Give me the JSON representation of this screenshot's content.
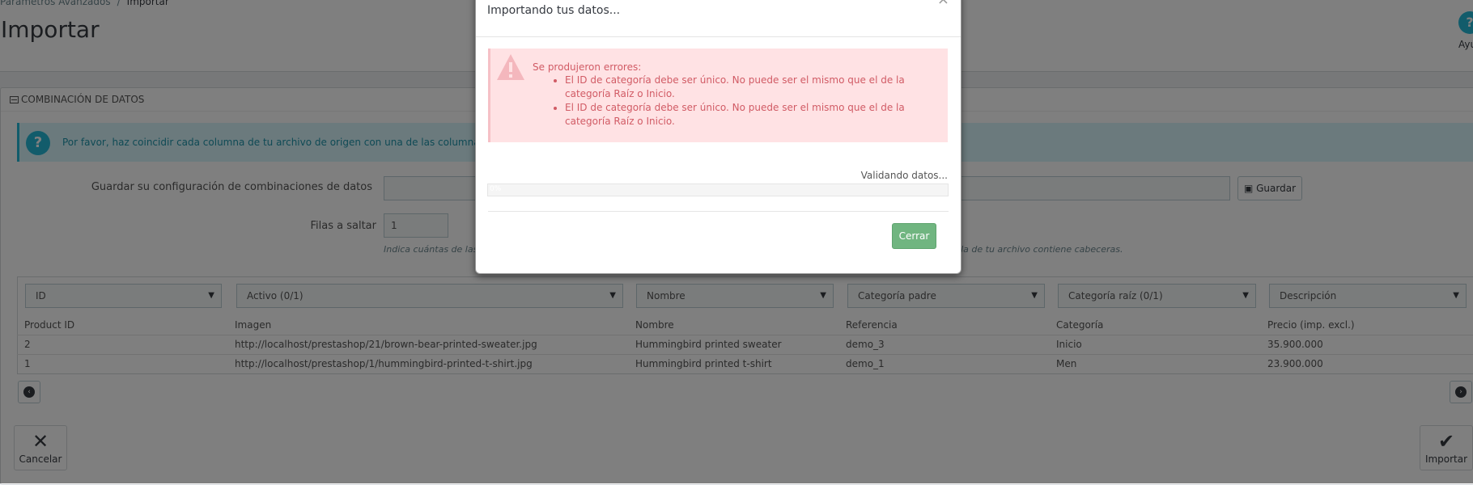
{
  "header": {
    "breadcrumb": [
      "Parámetros Avanzados",
      "Importar"
    ],
    "title": "Importar",
    "help_label": "Ayuda"
  },
  "panel": {
    "heading": "COMBINACIÓN DE DATOS",
    "info_text": "Por favor, haz coincidir cada columna de tu archivo de origen con una de las columnas de d",
    "save_config_label": "Guardar su configuración de combinaciones de datos",
    "save_config_value": "",
    "save_button": "Guardar",
    "skip_rows_label": "Filas a saltar",
    "skip_rows_value": "1",
    "help_left": "Indica cuántas de las",
    "help_right": "fila de tu archivo contiene cabeceras.",
    "selects": [
      "ID",
      "Activo (0/1)",
      "Nombre",
      "Categoría padre",
      "Categoría raíz (0/1)",
      "Descripción"
    ],
    "columns": [
      "Product ID",
      "Imagen",
      "Nombre",
      "Referencia",
      "Categoría",
      "Precio (imp. excl.)"
    ],
    "rows": [
      [
        "2",
        "http://localhost/prestashop/21/brown-bear-printed-sweater.jpg",
        "Hummingbird printed sweater",
        "demo_3",
        "Inicio",
        "35.900.000"
      ],
      [
        "1",
        "http://localhost/prestashop/1/hummingbird-printed-t-shirt.jpg",
        "Hummingbird printed t-shirt",
        "demo_1",
        "Men",
        "23.900.000"
      ]
    ],
    "cancel_label": "Cancelar",
    "import_label": "Importar"
  },
  "modal": {
    "title": "Importando tus datos...",
    "close": "×",
    "error_heading": "Se produjeron errores:",
    "errors": [
      "El ID de categoría debe ser único. No puede ser el mismo que el de la categoría Raíz o Inicio.",
      "El ID de categoría debe ser único. No puede ser el mismo que el de la categoría Raíz o Inicio."
    ],
    "status": "Validando datos...",
    "progress_percent": 0,
    "progress_label": "0%",
    "close_button": "Cerrar"
  },
  "colors": {
    "primary": "#25b9d7",
    "success": "#70b580",
    "danger_bg": "#ffe2e4",
    "danger_text": "#d15b65"
  }
}
